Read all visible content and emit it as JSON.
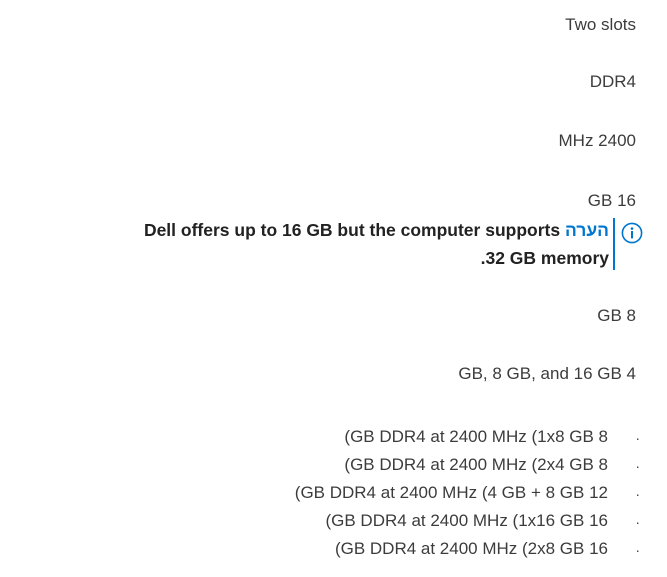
{
  "memory": {
    "slots": "Two slots",
    "type": "DDR4",
    "speed": "MHz 2400",
    "maximum": "GB 16",
    "note": {
      "label": "הערה",
      "line1": "Dell offers up to 16 GB but the computer supports",
      "line2": ".32 GB memory"
    },
    "minimum": "GB 8",
    "options": "GB, 8 GB, and 16 GB 4",
    "bullet_glyph": "·",
    "configurations": [
      "(GB DDR4 at 2400 MHz (1x8 GB 8",
      "(GB DDR4 at 2400 MHz (2x4 GB 8",
      "(GB DDR4 at 2400 MHz (4 GB + 8 GB 12",
      "(GB DDR4 at 2400 MHz (1x16 GB 16",
      "(GB DDR4 at 2400 MHz (2x8 GB 16"
    ]
  },
  "colors": {
    "text": "#3c3c3c",
    "note_text": "#222222",
    "accent": "#0076ce"
  },
  "icons": {
    "note": "info-icon"
  }
}
